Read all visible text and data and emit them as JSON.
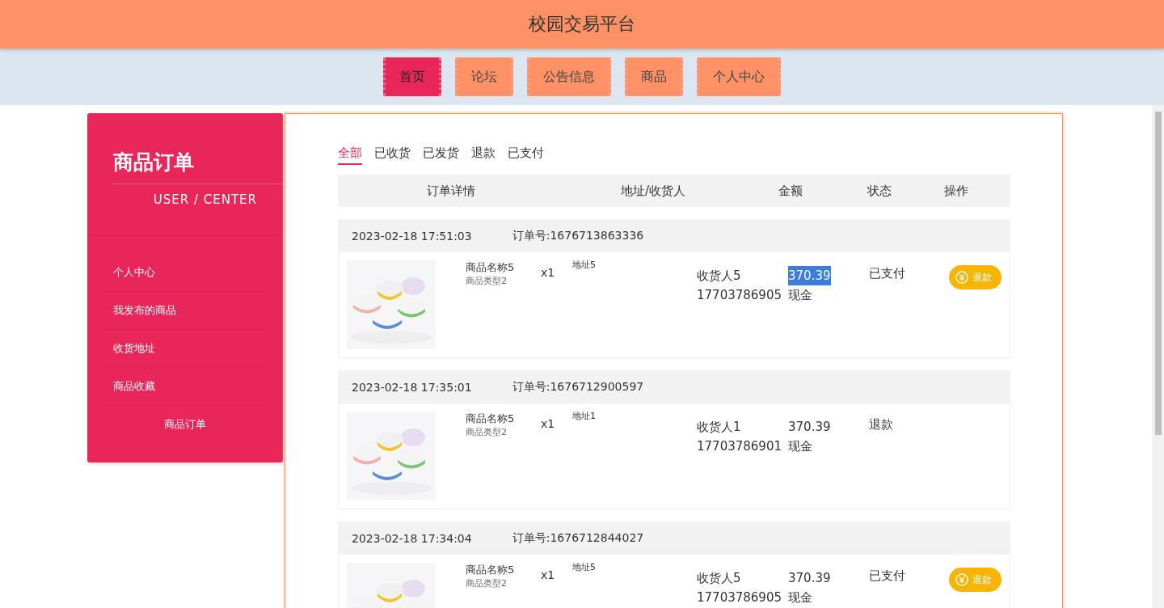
{
  "header": {
    "title": "校园交易平台"
  },
  "nav": [
    {
      "label": "首页",
      "selected": true
    },
    {
      "label": "论坛",
      "selected": false
    },
    {
      "label": "公告信息",
      "selected": false
    },
    {
      "label": "商品",
      "selected": false
    },
    {
      "label": "个人中心",
      "selected": false
    }
  ],
  "sidebar": {
    "title": "商品订单",
    "subtitle": "USER / CENTER",
    "items": [
      {
        "label": "个人中心",
        "selected": false
      },
      {
        "label": "我发布的商品",
        "selected": false
      },
      {
        "label": "收货地址",
        "selected": false
      },
      {
        "label": "商品收藏",
        "selected": false
      },
      {
        "label": "商品订单",
        "selected": true
      }
    ]
  },
  "filter_tabs": [
    {
      "label": "全部",
      "selected": true
    },
    {
      "label": "已收货",
      "selected": false
    },
    {
      "label": "已发货",
      "selected": false
    },
    {
      "label": "退款",
      "selected": false
    },
    {
      "label": "已支付",
      "selected": false
    }
  ],
  "table": {
    "columns": [
      "订单详情",
      "地址/收货人",
      "金额",
      "状态",
      "操作"
    ],
    "orders": [
      {
        "time": "2023-02-18 17:51:03",
        "order_no": "订单号:1676713863336",
        "name": "商品名称5",
        "type": "商品类型2",
        "quantity": "x1",
        "address": "地址5",
        "receiver": "收货人5",
        "phone": "17703786905",
        "amount": "370.39",
        "amount_selected": true,
        "payment": "现金",
        "status": "已支付",
        "action": "退款"
      },
      {
        "time": "2023-02-18 17:35:01",
        "order_no": "订单号:1676712900597",
        "name": "商品名称5",
        "type": "商品类型2",
        "quantity": "x1",
        "address": "地址1",
        "receiver": "收货人1",
        "phone": "17703786901",
        "amount": "370.39",
        "amount_selected": false,
        "payment": "现金",
        "status": "退款"
      },
      {
        "time": "2023-02-18 17:34:04",
        "order_no": "订单号:1676712844027",
        "name": "商品名称5",
        "type": "商品类型2",
        "quantity": "x1",
        "address": "地址5",
        "receiver": "收货人5",
        "phone": "17703786905",
        "amount": "370.39",
        "amount_selected": false,
        "payment": "现金",
        "status": "已支付",
        "action": "退款"
      }
    ]
  }
}
